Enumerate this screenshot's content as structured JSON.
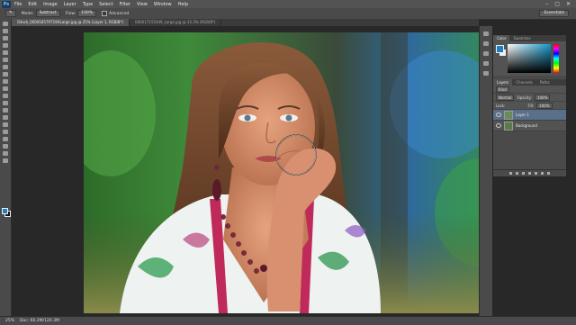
{
  "menubar": {
    "logo": "Ps",
    "items": [
      "File",
      "Edit",
      "Image",
      "Layer",
      "Type",
      "Select",
      "Filter",
      "View",
      "Window",
      "Help"
    ],
    "controls": [
      "–",
      "▢",
      "✕"
    ]
  },
  "options": {
    "mode_label": "Mode:",
    "mode_value": "Subtract",
    "flow_label": "Flow:",
    "flow_value": "100%",
    "airbrush_label": "Advanced",
    "workspace": "Essentials"
  },
  "tabs": [
    {
      "label": "iStock_000018579719XLarge.jpg @ 25% (Layer 1, RGB/8*)",
      "active": true
    },
    {
      "label": "000017155449_Large.jpg @ 33.3% (RGB/8*)",
      "active": false
    }
  ],
  "status": {
    "zoom": "25%",
    "doc": "Doc: 60.2M/120.3M"
  },
  "panel": {
    "color_tabs": [
      "Color",
      "Swatches"
    ],
    "layers_tabs": [
      "Layers",
      "Channels",
      "Paths"
    ],
    "kind": "Kind",
    "blend": "Normal",
    "opacity_label": "Opacity:",
    "opacity": "100%",
    "lock_label": "Lock:",
    "fill_label": "Fill:",
    "fill": "100%",
    "layers": [
      {
        "name": "Layer 1",
        "selected": true
      },
      {
        "name": "Background",
        "selected": false
      }
    ]
  },
  "colors": {
    "accent": "#1f7fc4",
    "ui": "#4a4a4a"
  }
}
